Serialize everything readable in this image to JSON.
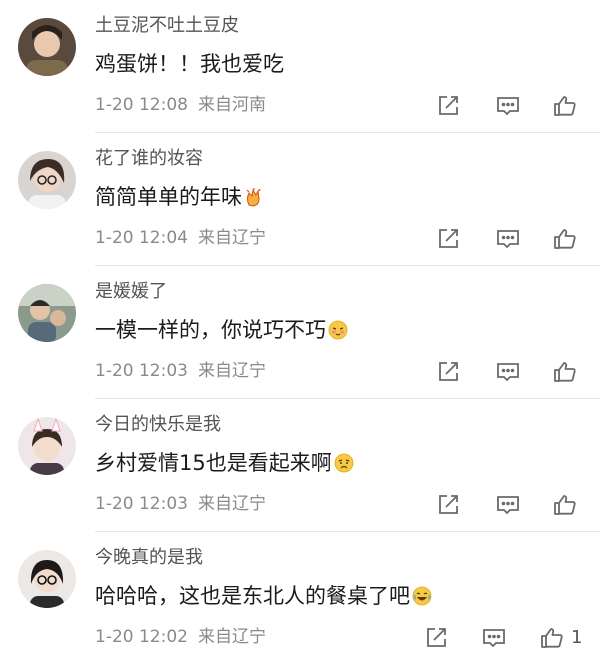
{
  "comments": [
    {
      "username": "土豆泥不吐土豆皮",
      "text": "鸡蛋饼！！我也爱吃",
      "time": "1-20 12:08",
      "location": "来自河南",
      "emoji": "",
      "like_count": ""
    },
    {
      "username": "花了谁的妆容",
      "text": "简简单单的年味",
      "time": "1-20 12:04",
      "location": "来自辽宁",
      "emoji": "clapping-hands-emoji",
      "like_count": ""
    },
    {
      "username": "是媛媛了",
      "text": "一模一样的，你说巧不巧",
      "time": "1-20 12:03",
      "location": "来自辽宁",
      "emoji": "embarrassed-face-emoji",
      "like_count": ""
    },
    {
      "username": "今日的快乐是我",
      "text": "乡村爱情15也是看起来啊",
      "time": "1-20 12:03",
      "location": "来自辽宁",
      "emoji": "sad-face-emoji",
      "like_count": ""
    },
    {
      "username": "今晚真的是我",
      "text": "哈哈哈，这也是东北人的餐桌了吧",
      "time": "1-20 12:02",
      "location": "来自辽宁",
      "emoji": "laughing-tears-emoji",
      "like_count": "1"
    }
  ],
  "colors": {
    "username": "#545454",
    "text": "#1b1b1b",
    "meta": "#8a8a8a",
    "icon": "#6a6a6a",
    "divider": "#e6e6e6"
  }
}
